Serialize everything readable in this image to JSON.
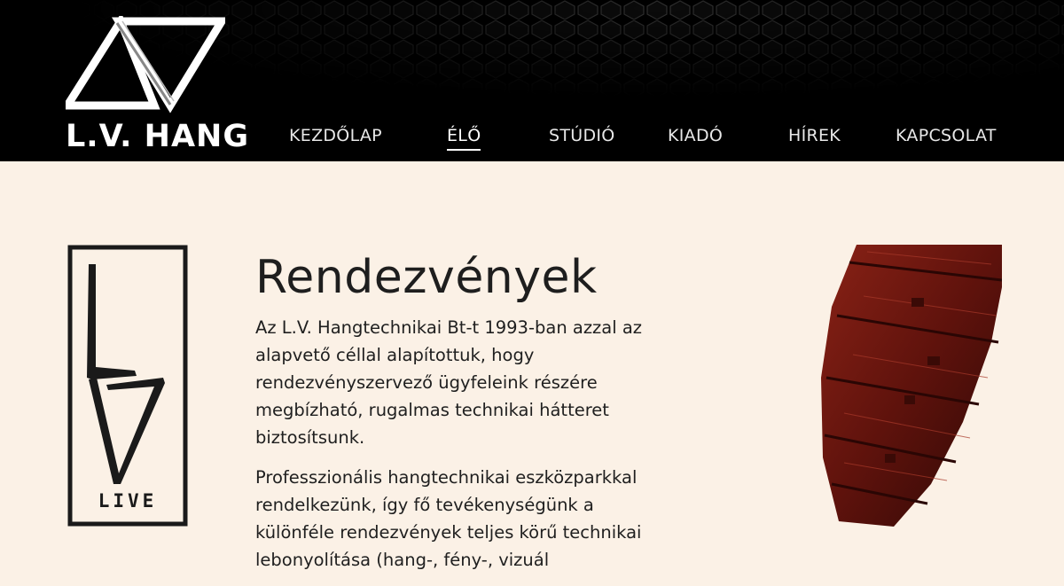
{
  "header": {
    "logo_text": "L.V. HANG",
    "nav": [
      {
        "label": "KEZDŐLAP",
        "active": false
      },
      {
        "label": "ÉLŐ",
        "active": true
      },
      {
        "label": "STÚDIÓ",
        "active": false
      },
      {
        "label": "KIADÓ",
        "active": false
      },
      {
        "label": "HÍREK",
        "active": false
      },
      {
        "label": "KAPCSOLAT",
        "active": false
      }
    ]
  },
  "badge": {
    "text": "LIVE"
  },
  "main": {
    "title": "Rendezvények",
    "paragraphs": [
      "Az L.V. Hangtechnikai Bt-t 1993-ban azzal az alapvető céllal alapítottuk, hogy rendezvényszervező ügyfeleink részére megbízható, rugalmas technikai hátteret biztosítsunk.",
      "Professzionális hangtechnikai eszközparkkal rendelkezünk, így fő tevékenységünk a különféle rendezvények teljes körű technikai lebonyolítása (hang-, fény-, vizuál"
    ]
  },
  "colors": {
    "header_bg": "#000000",
    "page_bg": "#fbf1e6",
    "speaker_red": "#7a1a12"
  }
}
